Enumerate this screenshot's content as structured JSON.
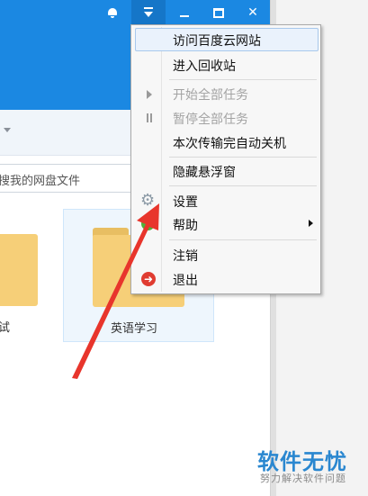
{
  "search": {
    "value": "搜我的网盘文件"
  },
  "folders": [
    {
      "name": "试"
    },
    {
      "name": "英语学习"
    }
  ],
  "menu": {
    "items": [
      {
        "label": "访问百度云网站"
      },
      {
        "label": "进入回收站"
      },
      {
        "label": "开始全部任务",
        "icon": "play-icon"
      },
      {
        "label": "暂停全部任务",
        "icon": "pause-icon"
      },
      {
        "label": "本次传输完自动关机"
      },
      {
        "label": "隐藏悬浮窗"
      },
      {
        "label": "设置",
        "icon": "gear-icon"
      },
      {
        "label": "帮助",
        "icon": "help-icon"
      },
      {
        "label": "注销"
      },
      {
        "label": "退出",
        "icon": "exit-icon"
      }
    ]
  },
  "colors": {
    "titlebar": "#1b88e2",
    "arrow": "#e8352c",
    "highlight": "#eaf2fc"
  },
  "watermark": {
    "title": "软件无忧",
    "subtitle": "努力解决软件问题"
  }
}
